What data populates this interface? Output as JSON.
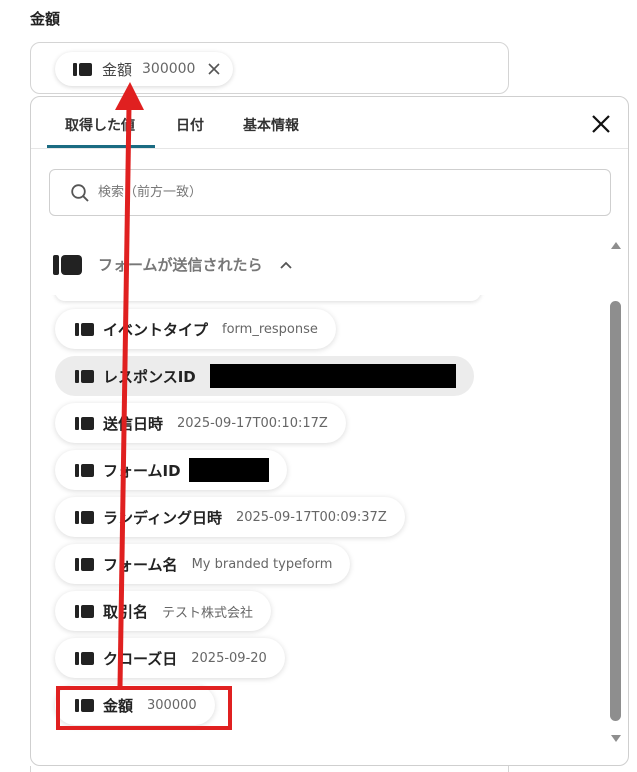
{
  "field": {
    "label": "金額"
  },
  "selected_chip": {
    "name": "金額",
    "value": "300000",
    "remove_icon": "close-icon"
  },
  "tabs": [
    {
      "label": "取得した値",
      "active": true
    },
    {
      "label": "日付",
      "active": false
    },
    {
      "label": "基本情報",
      "active": false
    }
  ],
  "search": {
    "placeholder": "検索（前方一致）",
    "value": ""
  },
  "group": {
    "title": "フォームが送信されたら",
    "expanded": true
  },
  "items": [
    {
      "name": "イベントタイプ",
      "value": "form_response",
      "redacted": false
    },
    {
      "name": "レスポンスID",
      "value": "",
      "redacted": true
    },
    {
      "name": "送信日時",
      "value": "2025-09-17T00:10:17Z",
      "redacted": false
    },
    {
      "name": "フォームID",
      "value": "",
      "redacted": true
    },
    {
      "name": "ランディング日時",
      "value": "2025-09-17T00:09:37Z",
      "redacted": false
    },
    {
      "name": "フォーム名",
      "value": "My branded typeform",
      "redacted": false
    },
    {
      "name": "取引名",
      "value": "テスト株式会社",
      "redacted": false
    },
    {
      "name": "クローズ日",
      "value": "2025-09-20",
      "redacted": false
    },
    {
      "name": "金額",
      "value": "300000",
      "redacted": false
    }
  ],
  "colors": {
    "tab_underline": "#1a6b82",
    "annotation": "#e02020",
    "redaction": "#000000"
  }
}
